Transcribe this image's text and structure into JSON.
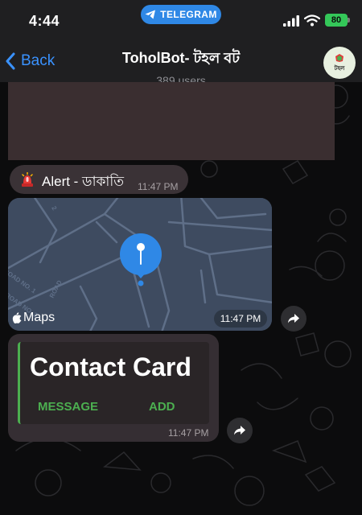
{
  "status_bar": {
    "time": "4:44",
    "app_pill": "TELEGRAM",
    "battery": "80",
    "icons": [
      "signal-icon",
      "wifi-icon",
      "battery-icon"
    ]
  },
  "header": {
    "back_label": "Back",
    "title": "ToholBot- টহল বট",
    "subtitle": "389 users",
    "avatar_text": "টহল",
    "accent": "#3a92ff"
  },
  "messages": {
    "alert": {
      "text": "Alert - ডাকাতি",
      "time": "11:47 PM",
      "icon": "siren-icon"
    },
    "map": {
      "brand": "Maps",
      "time": "11:47 PM",
      "street_labels": [
        "ROAD NO. 1",
        "ROAD NO. 2",
        "ROAD",
        "2"
      ]
    },
    "contact": {
      "title": "Contact Card",
      "message_button": "MESSAGE",
      "add_button": "ADD",
      "time": "11:47 PM",
      "accent": "#4caf50"
    }
  },
  "colors": {
    "pill": "#2f88e6",
    "battery": "#34c759",
    "background": "#0c0c0d"
  }
}
